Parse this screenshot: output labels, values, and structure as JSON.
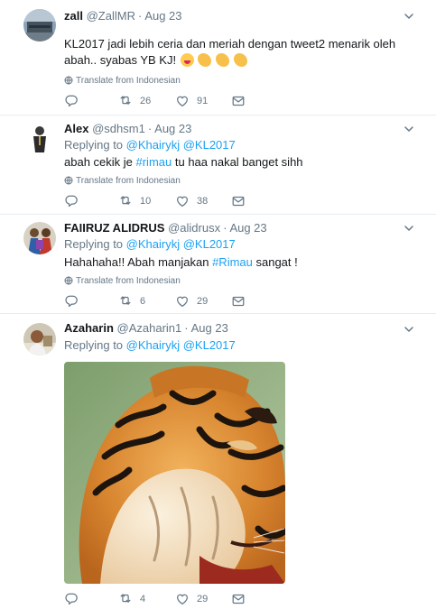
{
  "tweets": [
    {
      "name": "zall",
      "handle": "@ZallMR",
      "time": "Aug 23",
      "text": "KL2017 jadi lebih ceria dan meriah dengan tweet2 menarik oleh abah.. syabas YB KJ!",
      "emojis": [
        "face-tongue-emoji",
        "clapping-hands-emoji",
        "clapping-hands-emoji",
        "clapping-hands-emoji"
      ],
      "translate": "Translate from Indonesian",
      "retweets": "26",
      "likes": "91"
    },
    {
      "name": "Alex",
      "handle": "@sdhsm1",
      "time": "Aug 23",
      "reply_prefix": "Replying to",
      "reply_to": "@Khairykj @KL2017",
      "text_before": "abah cekik je ",
      "hashtag": "#rimau",
      "text_after": " tu haa nakal banget sihh",
      "translate": "Translate from Indonesian",
      "retweets": "10",
      "likes": "38"
    },
    {
      "name": "FAIIRUZ ALIDRUS",
      "handle": "@alidrusx",
      "time": "Aug 23",
      "reply_prefix": "Replying to",
      "reply_to": "@Khairykj @KL2017",
      "text_before": "Hahahaha!! Abah manjakan ",
      "hashtag": "#Rimau",
      "text_after": " sangat !",
      "translate": "Translate from Indonesian",
      "retweets": "6",
      "likes": "29"
    },
    {
      "name": "Azaharin",
      "handle": "@Azaharin1",
      "time": "Aug 23",
      "reply_prefix": "Replying to",
      "reply_to": "@Khairykj @KL2017",
      "media": "tiger-facepalm-photo",
      "retweets": "4",
      "likes": "29"
    }
  ],
  "icons": {
    "reply": "reply-icon",
    "retweet": "retweet-icon",
    "like": "heart-icon",
    "dm": "envelope-icon",
    "more": "chevron-down-icon",
    "globe": "globe-icon"
  },
  "colors": {
    "link": "#1da1f2",
    "secondary": "#657786",
    "text": "#14171a",
    "divider": "#e6ecf0"
  }
}
